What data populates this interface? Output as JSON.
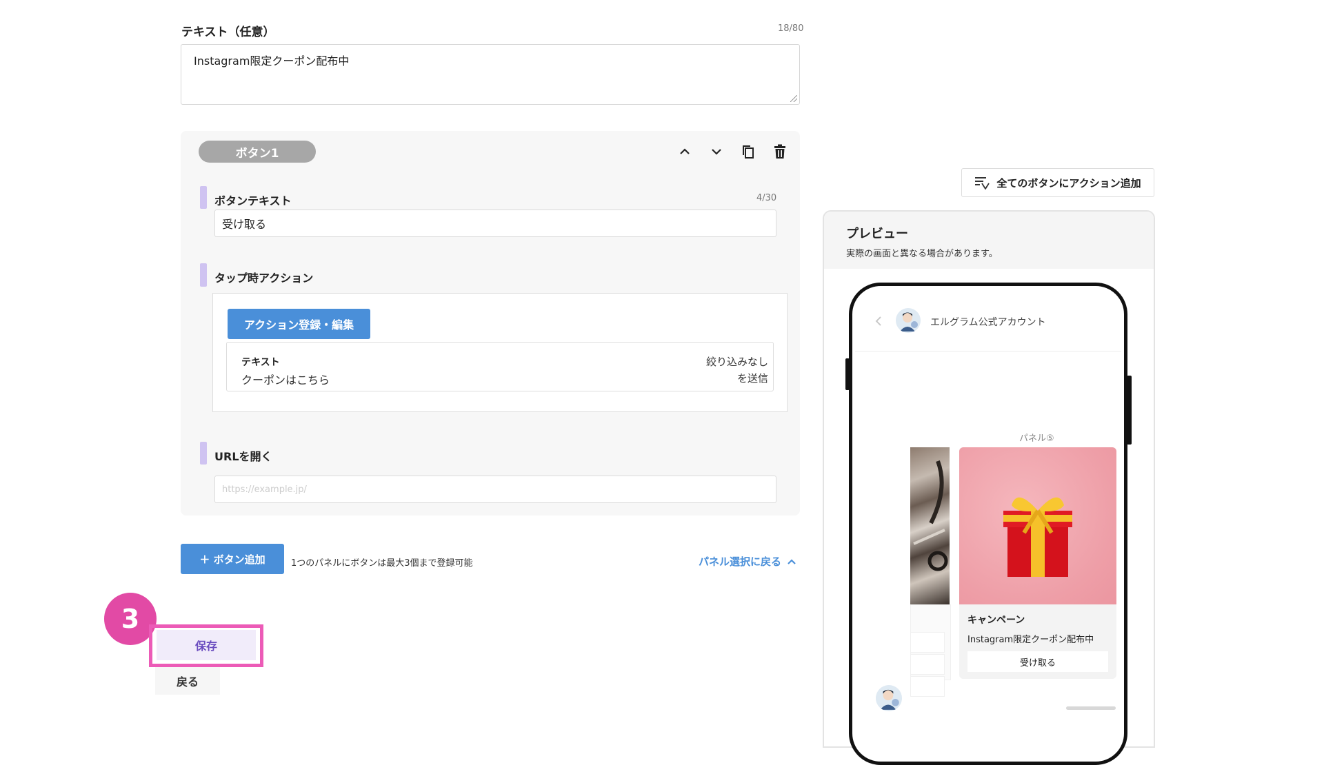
{
  "text_field": {
    "label": "テキスト（任意）",
    "counter": "18/80",
    "value": "Instagram限定クーポン配布中"
  },
  "button_card": {
    "pill_label": "ボタン1",
    "button_text": {
      "label": "ボタンテキスト",
      "counter": "4/30",
      "value": "受け取る"
    },
    "tap_action": {
      "label": "タップ時アクション",
      "register_button": "アクション登録・編集",
      "row_title": "テキスト",
      "row_value": "クーポンはこちら",
      "row_right_line1": "絞り込みなし",
      "row_right_line2": "を送信"
    },
    "open_url": {
      "label": "URLを開く",
      "placeholder": "https://example.jp/"
    }
  },
  "footer": {
    "add_button": "＋ ボタン追加",
    "note": "1つのパネルにボタンは最大3個まで登録可能",
    "back_to_panel": "パネル選択に戻る",
    "step_badge": "3",
    "save": "保存",
    "back": "戻る"
  },
  "preview": {
    "add_all_actions": "全てのボタンにアクション追加",
    "title": "プレビュー",
    "subtitle": "実際の画面と異なる場合があります。",
    "account_name": "エルグラム公式アカウント",
    "panel_label": "パネル⑤",
    "card_title": "キャンペーン",
    "card_text": "Instagram限定クーポン配布中",
    "card_button": "受け取る"
  },
  "colors": {
    "accent_blue": "#4a8fd9",
    "highlight_pink": "#ec5bb7",
    "badge_pink": "#e24aa5",
    "section_bar": "#cfc3f1"
  }
}
